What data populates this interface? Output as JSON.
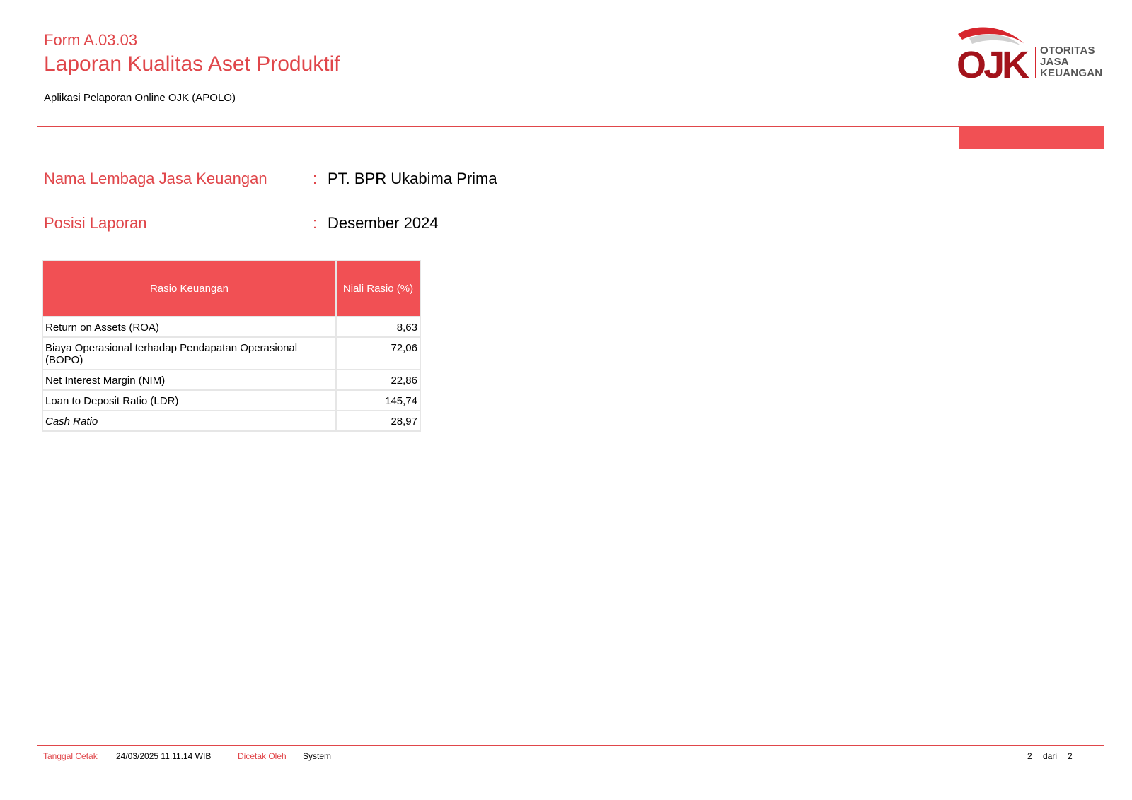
{
  "header": {
    "form_code": "Form A.03.03",
    "title": "Laporan Kualitas Aset Produktif",
    "app_name": "Aplikasi Pelaporan Online OJK (APOLO)",
    "logo": {
      "mark": "OJK",
      "lines": [
        "OTORITAS",
        "JASA",
        "KEUANGAN"
      ]
    }
  },
  "info": {
    "institution_label": "Nama Lembaga Jasa Keuangan",
    "institution_value": "PT. BPR Ukabima Prima",
    "period_label": "Posisi Laporan",
    "period_value": "Desember 2024",
    "colon": ":"
  },
  "table": {
    "headers": [
      "Rasio Keuangan",
      "Niali Rasio (%)"
    ],
    "rows": [
      {
        "name": "Return on Assets (ROA)",
        "value": "8,63"
      },
      {
        "name": "Biaya Operasional terhadap Pendapatan Operasional (BOPO)",
        "value": "72,06"
      },
      {
        "name": "Net Interest Margin (NIM)",
        "value": "22,86"
      },
      {
        "name": "Loan to Deposit Ratio (LDR)",
        "value": "145,74"
      },
      {
        "name": "Cash Ratio",
        "value": "28,97"
      }
    ]
  },
  "footer": {
    "print_date_label": "Tanggal Cetak",
    "print_date_value": "24/03/2025 11.11.14 WIB",
    "printed_by_label": "Dicetak Oleh",
    "printed_by_value": "System",
    "page_current": "2",
    "page_sep": "dari",
    "page_total": "2"
  },
  "colors": {
    "accent": "#e0464a",
    "header_fill": "#f15054",
    "logo_dark": "#a3131b",
    "logo_grey": "#555555"
  }
}
